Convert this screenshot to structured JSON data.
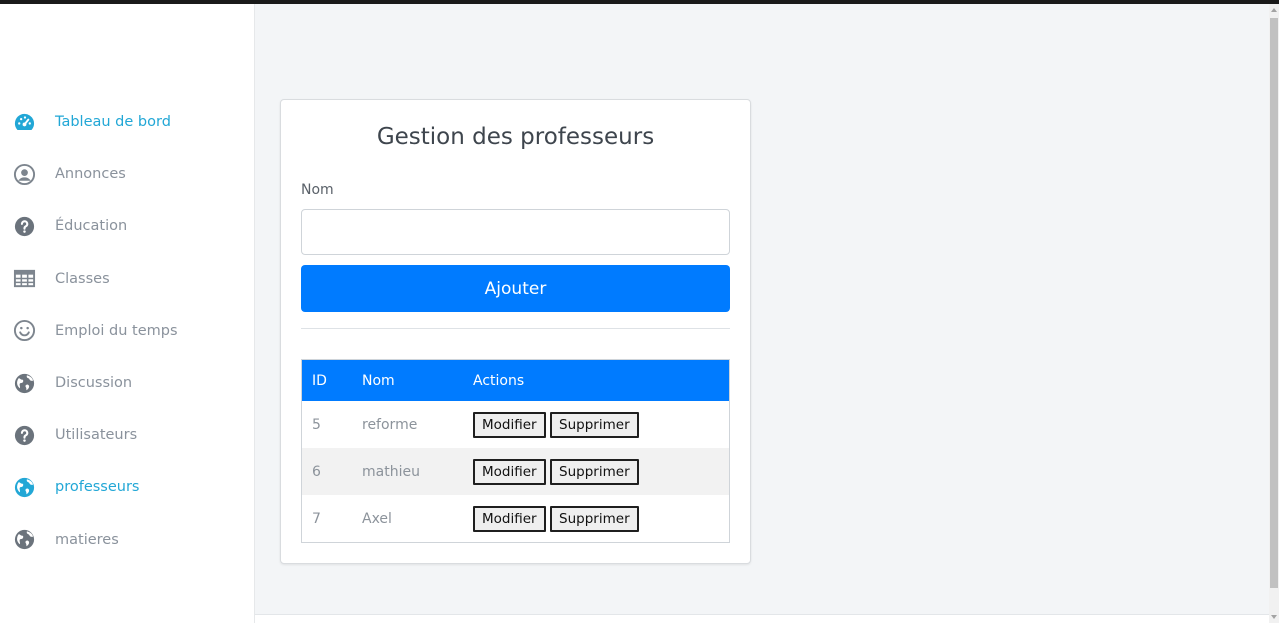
{
  "sidebar": {
    "items": [
      {
        "label": "Tableau de bord",
        "icon": "dashboard-gauge-icon",
        "active": true
      },
      {
        "label": "Annonces",
        "icon": "user-circle-icon",
        "active": false
      },
      {
        "label": "Éducation",
        "icon": "question-circle-icon",
        "active": false
      },
      {
        "label": "Classes",
        "icon": "table-grid-icon",
        "active": false
      },
      {
        "label": "Emploi du temps",
        "icon": "smile-icon",
        "active": false
      },
      {
        "label": "Discussion",
        "icon": "globe-icon",
        "active": false
      },
      {
        "label": "Utilisateurs",
        "icon": "question-circle-icon",
        "active": false
      },
      {
        "label": "professeurs",
        "icon": "globe-icon",
        "active": true
      },
      {
        "label": "matieres",
        "icon": "globe-icon",
        "active": false
      }
    ]
  },
  "form": {
    "title": "Gestion des professeurs",
    "name_label": "Nom",
    "name_value": "",
    "add_label": "Ajouter"
  },
  "table": {
    "headers": [
      "ID",
      "Nom",
      "Actions"
    ],
    "rows": [
      {
        "id": "5",
        "nom": "reforme"
      },
      {
        "id": "6",
        "nom": "mathieu"
      },
      {
        "id": "7",
        "nom": "Axel"
      }
    ],
    "edit_label": "Modifier",
    "delete_label": "Supprimer"
  },
  "colors": {
    "accent": "#22a7d6",
    "primary": "#007bff",
    "muted": "#8a929c"
  }
}
